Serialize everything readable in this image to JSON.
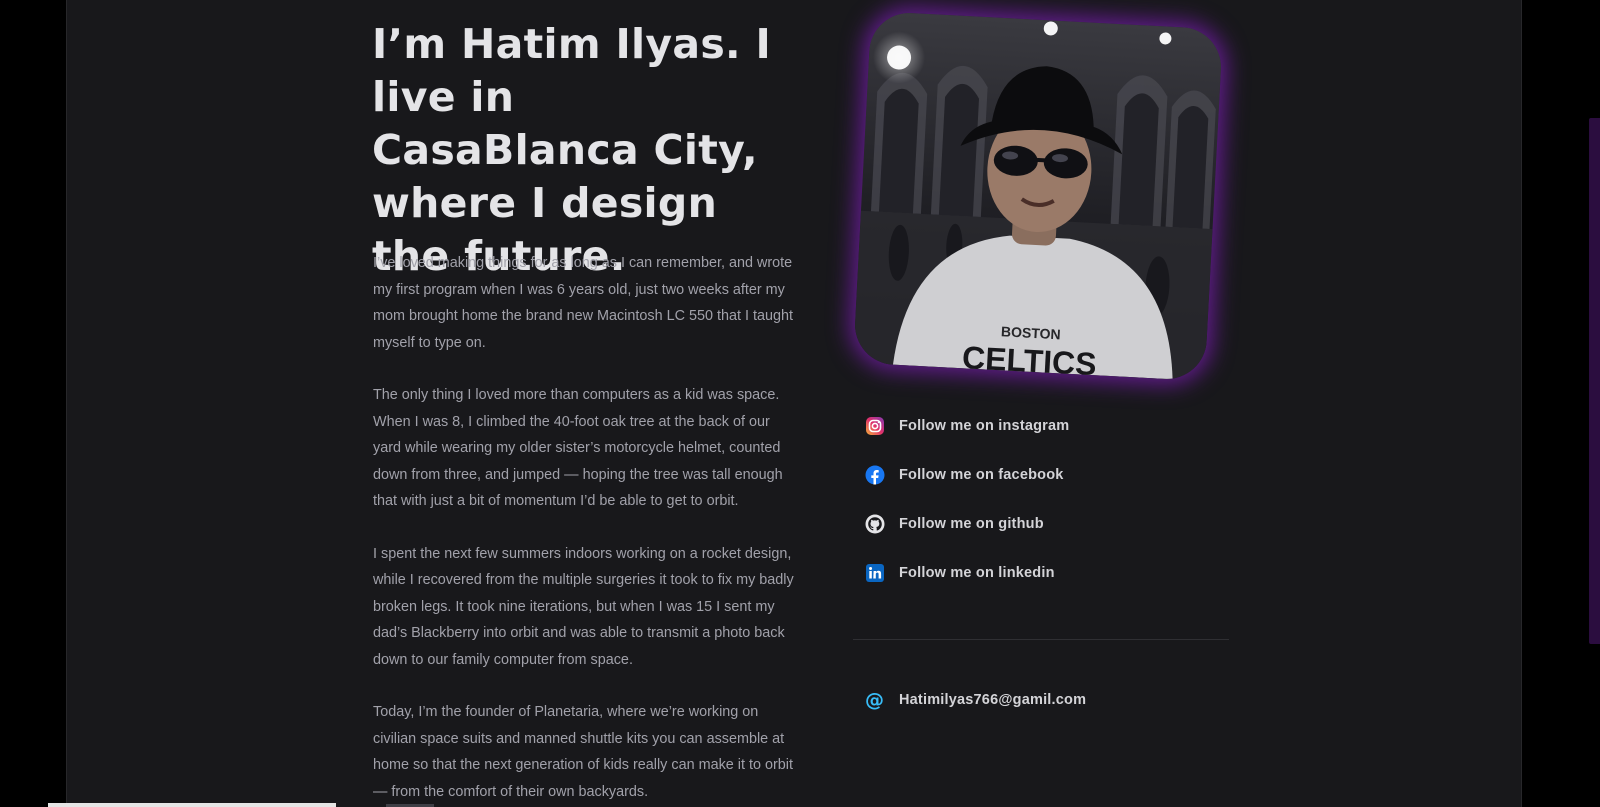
{
  "headline": "I’m Hatim Ilyas. I live in CasaBlanca City, where I design the future.",
  "bio": [
    "I’ve loved making things for as long as I can remember, and wrote my first program when I was 6 years old, just two weeks after my mom brought home the brand new Macintosh LC 550 that I taught myself to type on.",
    "The only thing I loved more than computers as a kid was space. When I was 8, I climbed the 40-foot oak tree at the back of our yard while wearing my older sister’s motorcycle helmet, counted down from three, and jumped — hoping the tree was tall enough that with just a bit of momentum I’d be able to get to orbit.",
    "I spent the next few summers indoors working on a rocket design, while I recovered from the multiple surgeries it took to fix my badly broken legs. It took nine iterations, but when I was 15 I sent my dad’s Blackberry into orbit and was able to transmit a photo back down to our family computer from space.",
    "Today, I’m the founder of Planetaria, where we’re working on civilian space suits and manned shuttle kits you can assemble at home so that the next generation of kids really can make it to orbit — from the comfort of their own backyards."
  ],
  "portrait": {
    "shirt_text": "BOSTON",
    "shirt_logo_text": "CELTICS",
    "glow_color": "#6e1ca0"
  },
  "social": [
    {
      "icon": "instagram-icon",
      "label": "Follow me on instagram"
    },
    {
      "icon": "facebook-icon",
      "label": "Follow me on facebook"
    },
    {
      "icon": "github-icon",
      "label": "Follow me on github"
    },
    {
      "icon": "linkedin-icon",
      "label": "Follow me on linkedin"
    }
  ],
  "email": {
    "icon": "at-sign-icon",
    "symbol": "@",
    "label": "Hatimilyas766@gamil.com"
  },
  "colors": {
    "background": "#18181b",
    "text_primary": "#e4e4e7",
    "text_secondary": "#a1a1aa",
    "accent": "#38bdf8"
  }
}
